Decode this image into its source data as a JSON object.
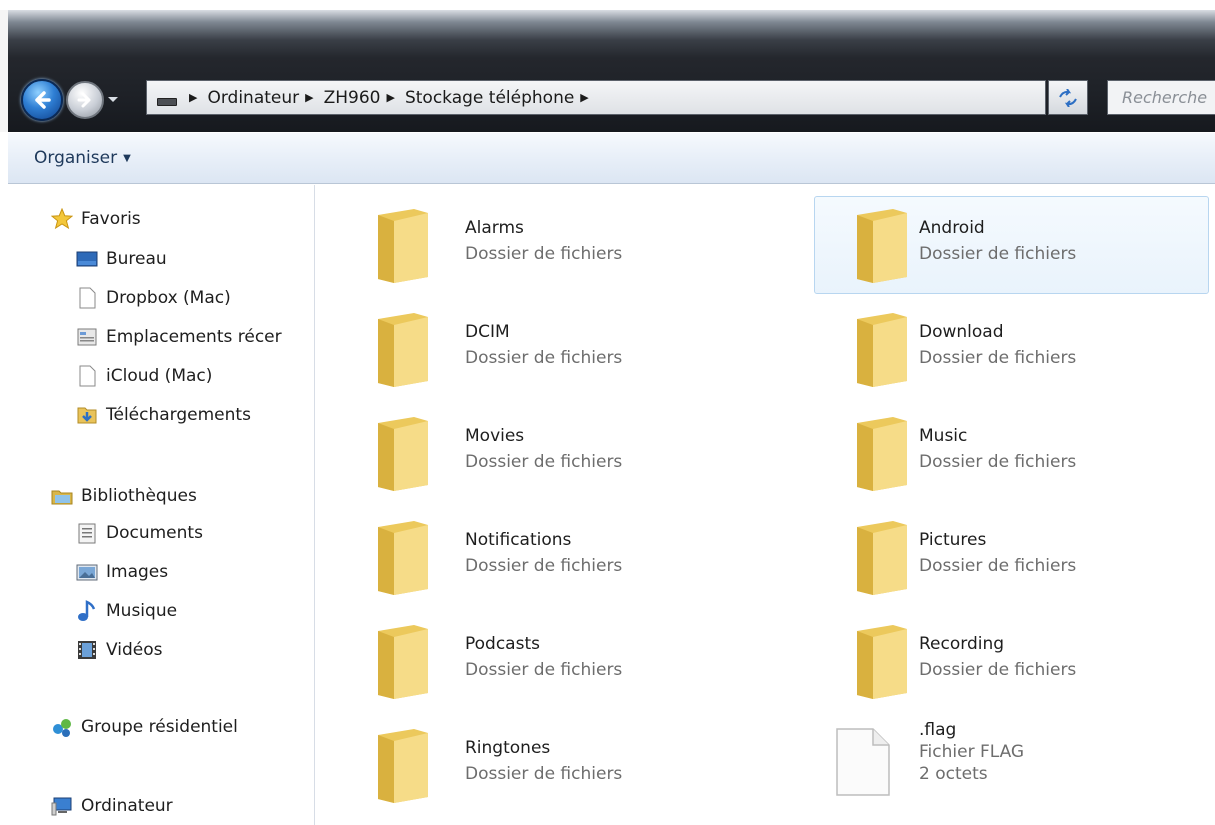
{
  "address": {
    "breadcrumbs": [
      "Ordinateur",
      "ZH960",
      "Stockage téléphone"
    ],
    "search_placeholder": "Recherche"
  },
  "toolbar": {
    "organize_label": "Organiser"
  },
  "sidebar": {
    "favorites": {
      "header": "Favoris",
      "items": [
        "Bureau",
        "Dropbox (Mac)",
        "Emplacements récer",
        "iCloud (Mac)",
        "Téléchargements"
      ]
    },
    "libraries": {
      "header": "Bibliothèques",
      "items": [
        "Documents",
        "Images",
        "Musique",
        "Vidéos"
      ]
    },
    "homegroup": "Groupe résidentiel",
    "computer": "Ordinateur"
  },
  "items": [
    {
      "name": "Alarms",
      "type": "Dossier de fichiers",
      "kind": "folder-icon"
    },
    {
      "name": "Android",
      "type": "Dossier de fichiers",
      "kind": "folder-icon",
      "selected": true
    },
    {
      "name": "DCIM",
      "type": "Dossier de fichiers",
      "kind": "folder-icon"
    },
    {
      "name": "Download",
      "type": "Dossier de fichiers",
      "kind": "folder-icon"
    },
    {
      "name": "Movies",
      "type": "Dossier de fichiers",
      "kind": "folder-icon"
    },
    {
      "name": "Music",
      "type": "Dossier de fichiers",
      "kind": "folder-icon"
    },
    {
      "name": "Notifications",
      "type": "Dossier de fichiers",
      "kind": "folder-icon"
    },
    {
      "name": "Pictures",
      "type": "Dossier de fichiers",
      "kind": "folder-icon"
    },
    {
      "name": "Podcasts",
      "type": "Dossier de fichiers",
      "kind": "folder-icon"
    },
    {
      "name": "Recording",
      "type": "Dossier de fichiers",
      "kind": "folder-icon"
    },
    {
      "name": "Ringtones",
      "type": "Dossier de fichiers",
      "kind": "folder-icon"
    },
    {
      "name": ".flag",
      "type": "Fichier FLAG",
      "size": "2 octets",
      "kind": "file-icon"
    }
  ],
  "colors": {
    "selection_border": "#b8d6f0",
    "commandbar_text": "#1e395b",
    "folder_yellow": "#f3d774"
  }
}
